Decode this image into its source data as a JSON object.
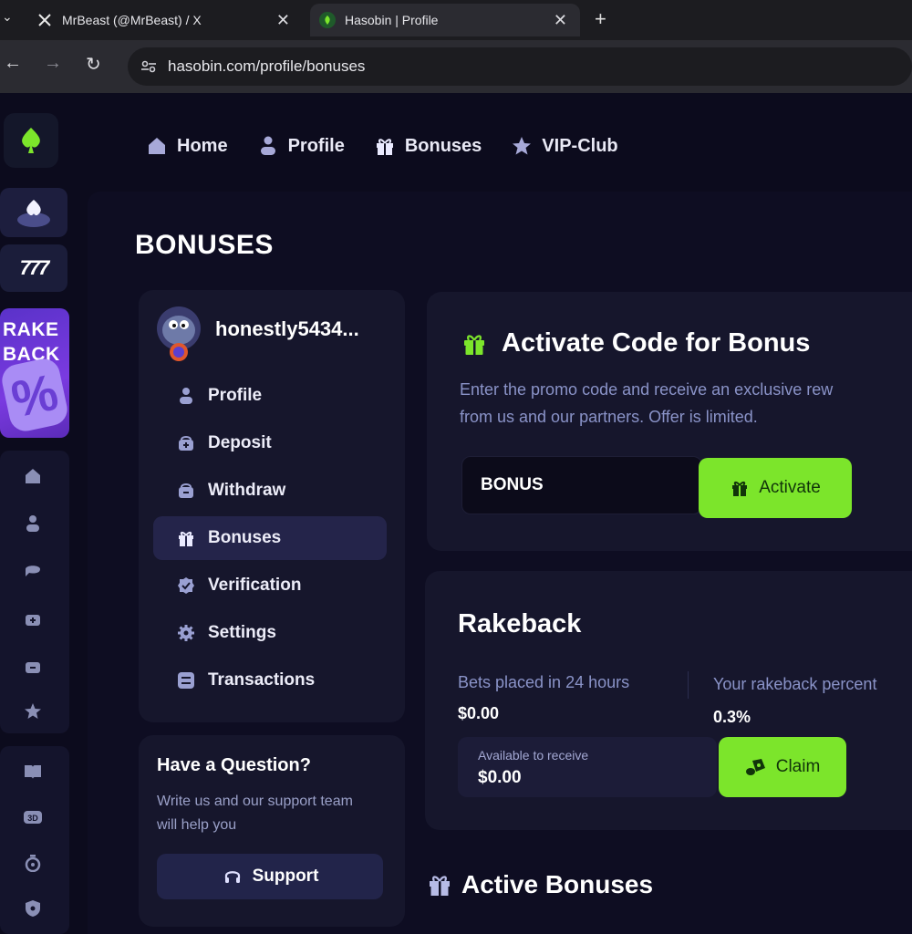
{
  "browser": {
    "tabs": [
      {
        "label": "MrBeast (@MrBeast) / X",
        "icon": "x-logo-icon"
      },
      {
        "label": "Hasobin | Profile",
        "icon": "hasobin-favicon-icon"
      }
    ],
    "url": "hasobin.com/profile/bonuses"
  },
  "colors": {
    "accent": "#7ce52b",
    "background": "#0c0b1d",
    "card": "#16162c",
    "muted_text": "#8a93c8"
  },
  "topnav": {
    "items": [
      {
        "label": "Home",
        "icon": "home-icon"
      },
      {
        "label": "Profile",
        "icon": "user-icon"
      },
      {
        "label": "Bonuses",
        "icon": "gift-icon"
      },
      {
        "label": "VIP-Club",
        "icon": "star-icon"
      }
    ]
  },
  "rail": {
    "rakeback_label": "RAKE BACK",
    "rakeback_symbol": "%",
    "game2_label": "777"
  },
  "page": {
    "title": "BONUSES"
  },
  "profile_menu": {
    "username": "honestly5434...",
    "items": [
      {
        "label": "Profile",
        "icon": "user-icon"
      },
      {
        "label": "Deposit",
        "icon": "wallet-plus-icon"
      },
      {
        "label": "Withdraw",
        "icon": "wallet-minus-icon"
      },
      {
        "label": "Bonuses",
        "icon": "gift-icon",
        "active": true
      },
      {
        "label": "Verification",
        "icon": "verified-badge-icon"
      },
      {
        "label": "Settings",
        "icon": "gear-icon"
      },
      {
        "label": "Transactions",
        "icon": "list-icon"
      }
    ]
  },
  "help": {
    "title": "Have a Question?",
    "text": "Write us and our support team will help you",
    "button": "Support"
  },
  "activate_code": {
    "title": "Activate Code for Bonus",
    "description_line1": "Enter the promo code and receive an exclusive rew",
    "description_line2": "from us and our partners. Offer is limited.",
    "input_value": "BONUS",
    "button": "Activate"
  },
  "rakeback": {
    "title": "Rakeback",
    "bets_label": "Bets placed in 24 hours",
    "bets_value": "$0.00",
    "percent_label": "Your rakeback percent",
    "percent_value": "0.3%",
    "available_label": "Available to receive",
    "available_value": "$0.00",
    "button": "Claim"
  },
  "active_bonuses": {
    "title": "Active Bonuses"
  }
}
